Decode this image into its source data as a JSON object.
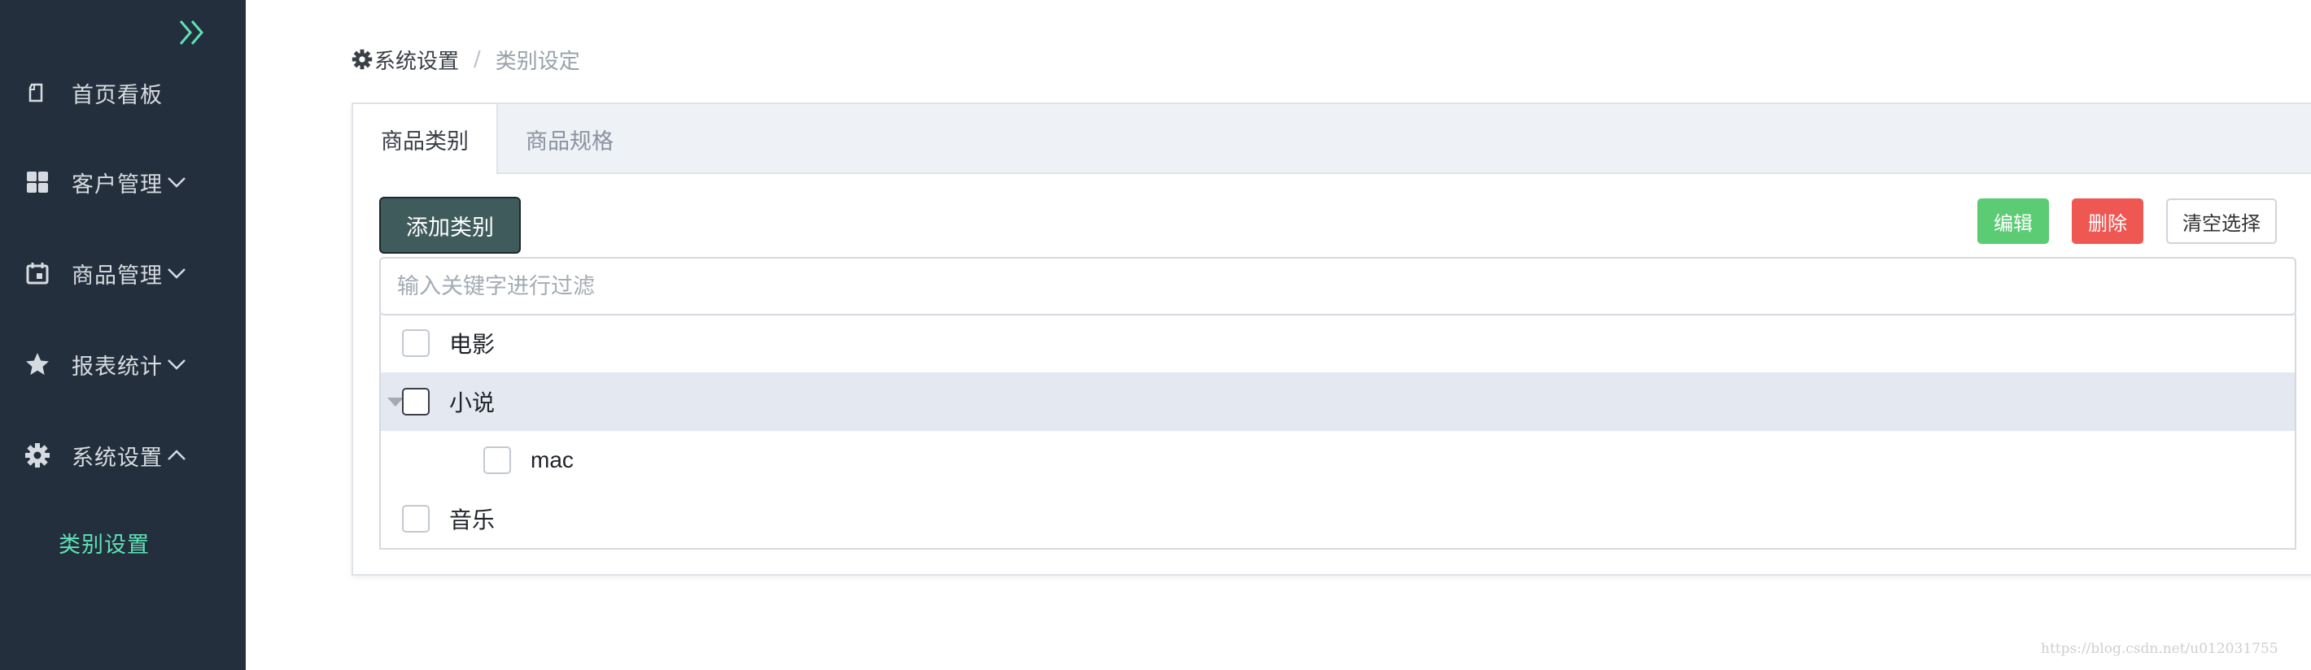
{
  "sidebar": {
    "collapse_icon": "double-chevron-right-icon",
    "items": [
      {
        "label": "首页看板",
        "icon": "document-icon"
      },
      {
        "label": "客户管理",
        "icon": "grid-icon",
        "arrow": "chevron-down-icon"
      },
      {
        "label": "商品管理",
        "icon": "calendar-icon",
        "arrow": "chevron-down-icon"
      },
      {
        "label": "报表统计",
        "icon": "star-icon",
        "arrow": "chevron-down-icon"
      },
      {
        "label": "系统设置",
        "icon": "gear-icon",
        "arrow": "chevron-up-icon"
      }
    ],
    "sub_item": "类别设置",
    "colors": {
      "background": "#232f3c",
      "active": "#5fe1b7"
    }
  },
  "breadcrumb": {
    "icon": "gear-icon",
    "first": "系统设置",
    "separator": "/",
    "current": "类别设定"
  },
  "tabs": [
    {
      "label": "商品类别",
      "active": true
    },
    {
      "label": "商品规格",
      "active": false
    }
  ],
  "toolbar": {
    "add_label": "添加类别",
    "edit_label": "编辑",
    "delete_label": "删除",
    "clear_label": "清空选择"
  },
  "filter": {
    "placeholder": "输入关键字进行过滤",
    "value": ""
  },
  "tree": [
    {
      "label": "电影",
      "level": 0,
      "checked": false
    },
    {
      "label": "小说",
      "level": 0,
      "checked": false,
      "expanded": true,
      "highlighted": true
    },
    {
      "label": "mac",
      "level": 1,
      "checked": false
    },
    {
      "label": "音乐",
      "level": 0,
      "checked": false
    }
  ],
  "watermark": "https://blog.csdn.net/u012031755"
}
